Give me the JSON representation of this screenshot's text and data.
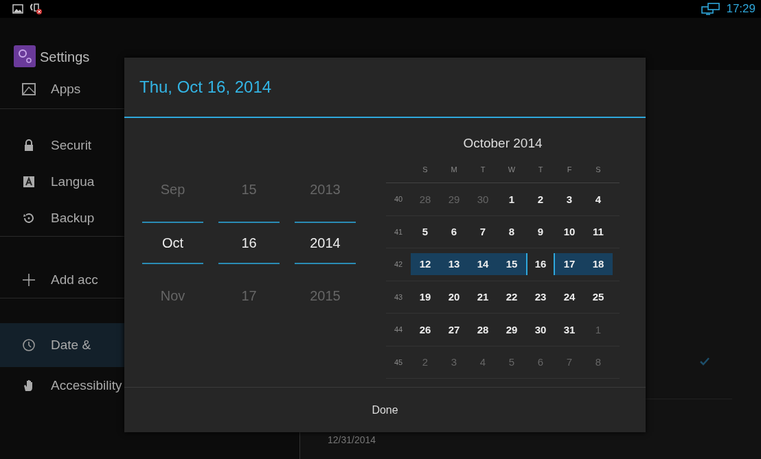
{
  "status_bar": {
    "time": "17:29"
  },
  "action_bar": {
    "title": "Settings"
  },
  "sidebar": {
    "items": [
      {
        "kind": "apps",
        "label": "Apps",
        "group_end": true
      },
      {
        "kind": "lock",
        "label": "Securit",
        "group_end": false
      },
      {
        "kind": "language",
        "label": "Langua",
        "group_end": false
      },
      {
        "kind": "backup",
        "label": "Backup",
        "group_end": true
      },
      {
        "kind": "add",
        "label": "Add acc",
        "group_end": true
      },
      {
        "kind": "clock",
        "label": "Date &",
        "group_end": false,
        "selected": true
      },
      {
        "kind": "hand",
        "label": "Accessibility",
        "group_end": false,
        "selected": false
      }
    ]
  },
  "detail": {
    "date_value": "12/31/2014"
  },
  "dialog": {
    "title": "Thu, Oct 16, 2014",
    "pickers": [
      {
        "previous": "Sep",
        "current": "Oct",
        "next": "Nov"
      },
      {
        "previous": "15",
        "current": "16",
        "next": "17"
      },
      {
        "previous": "2013",
        "current": "2014",
        "next": "2015"
      }
    ],
    "calendar": {
      "month": "October 2014",
      "weekdays": [
        "S",
        "M",
        "T",
        "W",
        "T",
        "F",
        "S"
      ],
      "weeks": [
        {
          "number": "40",
          "selected": false,
          "days": [
            {
              "label": "28",
              "in_month": false,
              "selected": false
            },
            {
              "label": "29",
              "in_month": false,
              "selected": false
            },
            {
              "label": "30",
              "in_month": false,
              "selected": false
            },
            {
              "label": "1",
              "in_month": true,
              "selected": false
            },
            {
              "label": "2",
              "in_month": true,
              "selected": false
            },
            {
              "label": "3",
              "in_month": true,
              "selected": false
            },
            {
              "label": "4",
              "in_month": true,
              "selected": false
            }
          ]
        },
        {
          "number": "41",
          "selected": false,
          "days": [
            {
              "label": "5",
              "in_month": true,
              "selected": false
            },
            {
              "label": "6",
              "in_month": true,
              "selected": false
            },
            {
              "label": "7",
              "in_month": true,
              "selected": false
            },
            {
              "label": "8",
              "in_month": true,
              "selected": false
            },
            {
              "label": "9",
              "in_month": true,
              "selected": false
            },
            {
              "label": "10",
              "in_month": true,
              "selected": false
            },
            {
              "label": "11",
              "in_month": true,
              "selected": false
            }
          ]
        },
        {
          "number": "42",
          "selected": true,
          "days": [
            {
              "label": "12",
              "in_month": true,
              "selected": false
            },
            {
              "label": "13",
              "in_month": true,
              "selected": false
            },
            {
              "label": "14",
              "in_month": true,
              "selected": false
            },
            {
              "label": "15",
              "in_month": true,
              "selected": false
            },
            {
              "label": "16",
              "in_month": true,
              "selected": true
            },
            {
              "label": "17",
              "in_month": true,
              "selected": false
            },
            {
              "label": "18",
              "in_month": true,
              "selected": false
            }
          ]
        },
        {
          "number": "43",
          "selected": false,
          "days": [
            {
              "label": "19",
              "in_month": true,
              "selected": false
            },
            {
              "label": "20",
              "in_month": true,
              "selected": false
            },
            {
              "label": "21",
              "in_month": true,
              "selected": false
            },
            {
              "label": "22",
              "in_month": true,
              "selected": false
            },
            {
              "label": "23",
              "in_month": true,
              "selected": false
            },
            {
              "label": "24",
              "in_month": true,
              "selected": false
            },
            {
              "label": "25",
              "in_month": true,
              "selected": false
            }
          ]
        },
        {
          "number": "44",
          "selected": false,
          "days": [
            {
              "label": "26",
              "in_month": true,
              "selected": false
            },
            {
              "label": "27",
              "in_month": true,
              "selected": false
            },
            {
              "label": "28",
              "in_month": true,
              "selected": false
            },
            {
              "label": "29",
              "in_month": true,
              "selected": false
            },
            {
              "label": "30",
              "in_month": true,
              "selected": false
            },
            {
              "label": "31",
              "in_month": true,
              "selected": false
            },
            {
              "label": "1",
              "in_month": false,
              "selected": false
            }
          ]
        },
        {
          "number": "45",
          "selected": false,
          "days": [
            {
              "label": "2",
              "in_month": false,
              "selected": false
            },
            {
              "label": "3",
              "in_month": false,
              "selected": false
            },
            {
              "label": "4",
              "in_month": false,
              "selected": false
            },
            {
              "label": "5",
              "in_month": false,
              "selected": false
            },
            {
              "label": "6",
              "in_month": false,
              "selected": false
            },
            {
              "label": "7",
              "in_month": false,
              "selected": false
            },
            {
              "label": "8",
              "in_month": false,
              "selected": false
            }
          ]
        }
      ]
    },
    "done_button": "Done"
  }
}
